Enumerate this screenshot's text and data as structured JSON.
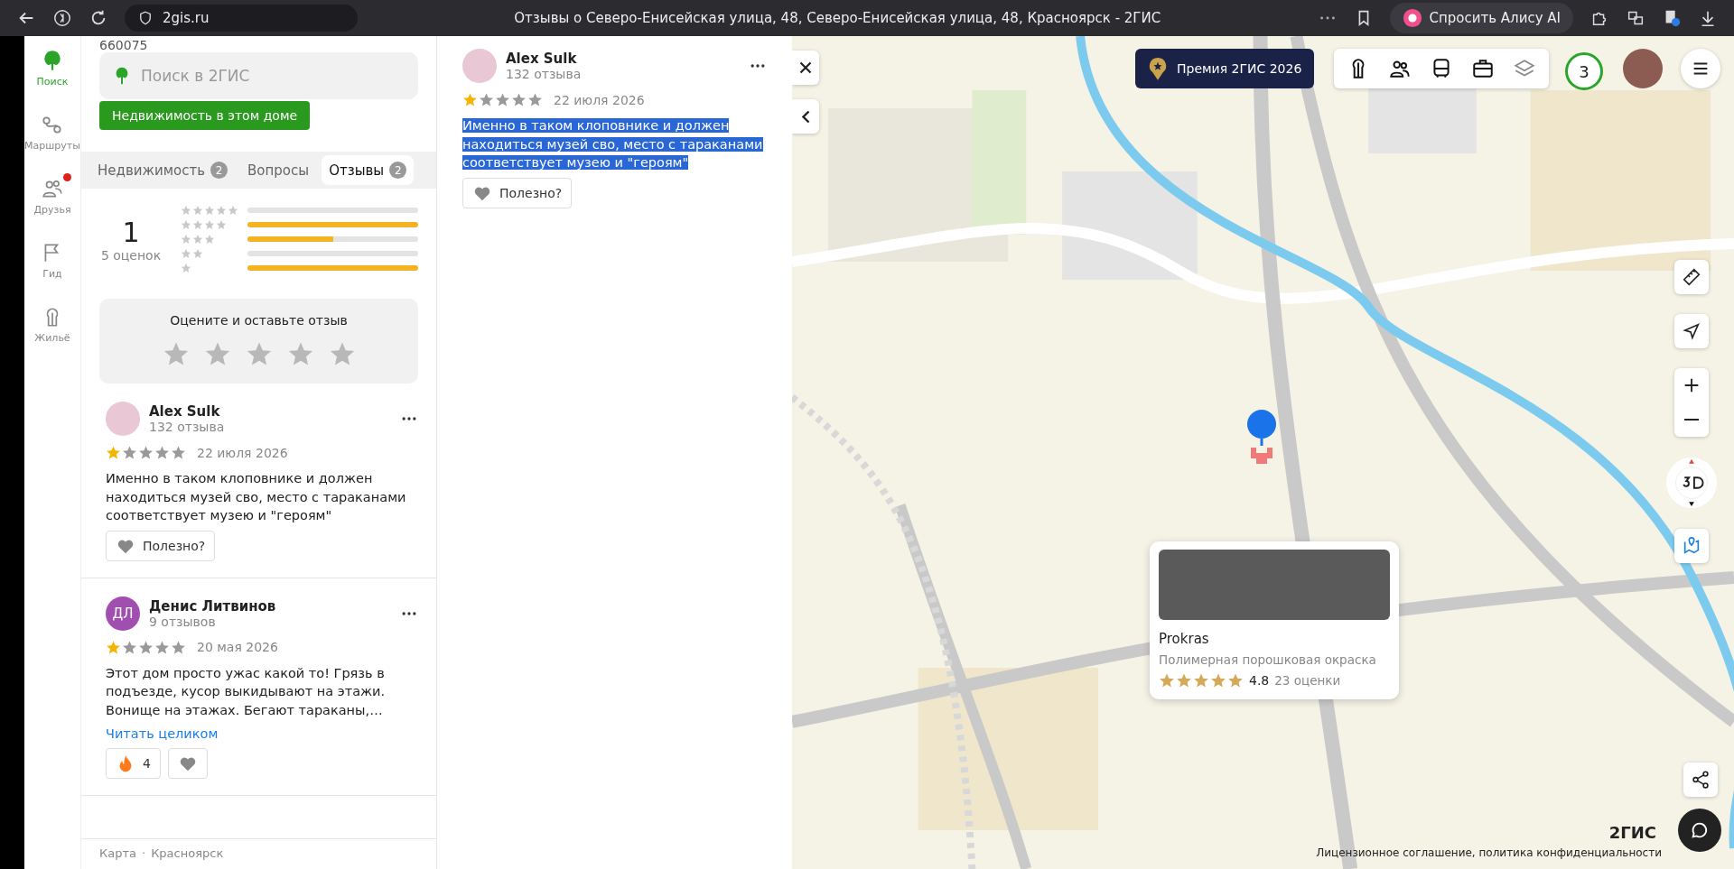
{
  "browser": {
    "address": "2gis.ru",
    "page_title": "Отзывы о Северо-Енисейская улица, 48, Северо-Енисейская улица, 48, Красноярск - 2ГИС",
    "assistant": "Спросить Алису AI"
  },
  "nav": [
    {
      "label": "Поиск",
      "selected": true,
      "kind": "search",
      "notification": false
    },
    {
      "label": "Маршруты",
      "selected": false,
      "kind": "routes",
      "notification": false
    },
    {
      "label": "Друзья",
      "selected": false,
      "kind": "friends",
      "notification": true
    },
    {
      "label": "Гид",
      "selected": false,
      "kind": "guide",
      "notification": false
    },
    {
      "label": "Жильё",
      "selected": false,
      "kind": "housing",
      "notification": false
    }
  ],
  "panel": {
    "postcode": "660075",
    "search": {
      "placeholder": "Поиск в 2ГИС"
    },
    "action_button": "Недвижимость в этом доме",
    "tabs": [
      {
        "label": "Недвижимость",
        "count": "2",
        "selected": false
      },
      {
        "label": "Вопросы",
        "selected": false
      },
      {
        "label": "Отзывы",
        "count": "2",
        "selected": true
      }
    ],
    "summary": {
      "score": "1",
      "count": "5 оценок",
      "bars": [
        {
          "level": 0
        },
        {
          "level": 1
        },
        {
          "level": 0.5
        },
        {
          "level": 0
        },
        {
          "level": 1
        }
      ]
    },
    "rate_box": {
      "title": "Оцените и оставьте отзыв",
      "stars": 0
    },
    "reviews": [
      {
        "author": "Alex Sulk",
        "reviews_count": "132 отзыва",
        "stars": 1,
        "date": "22 июля 2026",
        "text": "Именно в таком клоповнике и должен находиться музей сво, место с тараканами соответствует музею и \"героям\"",
        "helpful": "Полезно?"
      },
      {
        "author": "Денис Литвинов",
        "initials": "ДЛ",
        "reviews_count": "9 отзывов",
        "stars": 1,
        "date": "20 мая 2026",
        "text": "Этот дом просто ужас какой то! Грязь в подъезде, кусор выкидывают на этажи. Вонище на этажах. Бегают тараканы,…",
        "read_more": "Читать целиком",
        "reactions": [
          {
            "kind": "fire",
            "count": "4"
          },
          {
            "kind": "heart"
          }
        ]
      }
    ],
    "footer": {
      "items": [
        "Карта",
        "Красноярск"
      ],
      "separator": "·"
    }
  },
  "detail": {
    "author": "Alex Sulk",
    "reviews_count": "132 отзыва",
    "stars": 1,
    "date": "22 июля 2026",
    "text": "Именно в таком клоповнике и должен находиться музей сво, место с тараканами соответствует музею и \"героям\"",
    "highlighted": true,
    "helpful": "Полезно?"
  },
  "map": {
    "award": "Премия 2ГИС 2026",
    "notifications": "3",
    "card": {
      "name": "Prokras",
      "subtitle": "Полимерная порошковая окраска",
      "stars": 5,
      "rating": "4.8",
      "count": "23 оценки"
    },
    "logo": "2ГИС",
    "license": "Лицензионное соглашение, политика конфиденциальности"
  }
}
